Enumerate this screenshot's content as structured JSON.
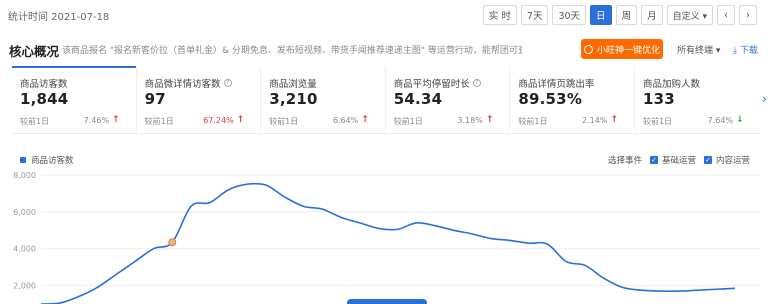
{
  "topbar": {
    "stat_time": "统计时间 2021-07-18",
    "ranges": [
      {
        "label": "实 时",
        "active": false
      },
      {
        "label": "7天",
        "active": false
      },
      {
        "label": "30天",
        "active": false
      },
      {
        "label": "日",
        "active": true
      },
      {
        "label": "周",
        "active": false
      },
      {
        "label": "月",
        "active": false
      },
      {
        "label": "自定义 ▾",
        "active": false
      }
    ],
    "prev_label": "‹",
    "next_label": "›"
  },
  "section": {
    "title": "核心概况",
    "description": "该商品报名 \"报名新客价拉（首单礼金）& 分期免息、发布短视频、带货手闻推荐速递主图\" 等运营行动，能帮团可查看操作记录并跟踪效...",
    "promo_label": "小旺神一键优化",
    "terminal_label": "所有终端 ▾",
    "download_label": "⤓ 下载"
  },
  "cards": [
    {
      "label": "商品访客数",
      "help": false,
      "value": "1,844",
      "compare": "较前1日",
      "pct": "7.46%",
      "trend": "up"
    },
    {
      "label": "商品微详情访客数",
      "help": true,
      "value": "97",
      "compare": "较前1日",
      "pct": "67.24%",
      "trend": "up"
    },
    {
      "label": "商品浏览量",
      "help": false,
      "value": "3,210",
      "compare": "较前1日",
      "pct": "6.64%",
      "trend": "up"
    },
    {
      "label": "商品平均停留时长",
      "help": true,
      "value": "54.34",
      "compare": "较前1日",
      "pct": "3.18%",
      "trend": "up"
    },
    {
      "label": "商品详情页跳出率",
      "help": false,
      "value": "89.53%",
      "compare": "较前1日",
      "pct": "2.14%",
      "trend": "up"
    },
    {
      "label": "商品加购人数",
      "help": false,
      "value": "133",
      "compare": "较前1日",
      "pct": "7.64%",
      "trend": "down"
    }
  ],
  "chart_controls": {
    "legend_label": "商品访客数",
    "events_label": "选择事件",
    "options": [
      "基础运营",
      "内容运营"
    ]
  },
  "chart_data": {
    "type": "line",
    "ylabel": "",
    "yticks": [
      "8,000",
      "6,000",
      "4,000",
      "2,000"
    ],
    "ylim": [
      1000,
      8000
    ],
    "series": [
      {
        "name": "商品访客数",
        "values": [
          1000,
          1050,
          1400,
          1900,
          2600,
          3300,
          4000,
          4350,
          6300,
          6500,
          7200,
          7500,
          7450,
          6800,
          6300,
          6150,
          5700,
          5400,
          5100,
          5050,
          5400,
          5250,
          5000,
          4800,
          4550,
          4450,
          4300,
          4250,
          3300,
          3100,
          2400,
          1900,
          1750,
          1700,
          1700,
          1750,
          1800,
          1850
        ]
      }
    ],
    "highlight_point_index": 7,
    "grid": true,
    "color": "#2a6fdb"
  },
  "colors": {
    "accent": "#2a6fdb",
    "promo": "#ff6a00",
    "up": "#e03a3a",
    "down": "#2aa34a"
  }
}
